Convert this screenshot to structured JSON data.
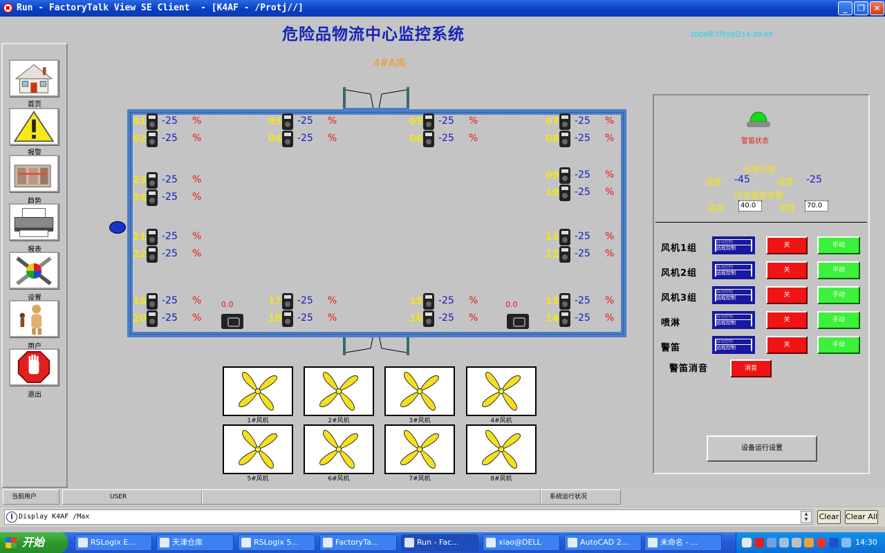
{
  "window": {
    "title": "Run - FactoryTalk View SE Client  - [K4AF - /Protj//]",
    "btn_minimize": "_",
    "btn_maximize": "❐",
    "btn_close": "✕"
  },
  "header": {
    "system_title": "危险品物流中心监控系统",
    "datetime": "2009年7月09日14:30:09"
  },
  "nav": [
    {
      "label": "首页",
      "icon": "home-icon"
    },
    {
      "label": "报警",
      "icon": "warning-icon"
    },
    {
      "label": "趋势",
      "icon": "trend-icon"
    },
    {
      "label": "报表",
      "icon": "printer-icon"
    },
    {
      "label": "设置",
      "icon": "settings-icon"
    },
    {
      "label": "用户",
      "icon": "user-icon"
    },
    {
      "label": "退出",
      "icon": "stop-hand-icon"
    }
  ],
  "warehouse": {
    "title": "4#A库",
    "percent_sign": "%",
    "value": "-25",
    "camera_reading": "0.0",
    "sensors": [
      {
        "num": "01"
      },
      {
        "num": "02"
      },
      {
        "num": "03"
      },
      {
        "num": "04"
      },
      {
        "num": "05"
      },
      {
        "num": "06"
      },
      {
        "num": "07"
      },
      {
        "num": "08"
      },
      {
        "num": "23"
      },
      {
        "num": "24"
      },
      {
        "num": "09"
      },
      {
        "num": "10"
      },
      {
        "num": "21"
      },
      {
        "num": "22"
      },
      {
        "num": "11"
      },
      {
        "num": "12"
      },
      {
        "num": "19"
      },
      {
        "num": "20"
      },
      {
        "num": "17"
      },
      {
        "num": "18"
      },
      {
        "num": "15"
      },
      {
        "num": "16"
      },
      {
        "num": "13"
      },
      {
        "num": "14"
      }
    ]
  },
  "fans": [
    "1#风机",
    "2#风机",
    "3#风机",
    "4#风机",
    "5#风机",
    "6#风机",
    "7#风机",
    "8#风机"
  ],
  "right_panel": {
    "alarm_status": "警笛状态",
    "env_title": "仓库环境",
    "temp_label": "温度",
    "temp_value": "-45",
    "humid_label": "湿度",
    "humid_value": "-25",
    "params_title": "环境报警参数",
    "param_temp_label": "温度",
    "param_temp_value": "40.0",
    "param_humid_label": "湿度",
    "param_humid_value": "70.0",
    "devices": [
      {
        "label": "风机1组"
      },
      {
        "label": "风机2组"
      },
      {
        "label": "风机3组"
      },
      {
        "label": "喷淋"
      },
      {
        "label": "警笛"
      }
    ],
    "status_line1": "自动控制",
    "status_line2": "远程控制",
    "off_label": "关",
    "manual_label": "手动",
    "mute_label": "警笛消音",
    "mute_button": "消音",
    "settings_button": "设备运行设置"
  },
  "status_strip": {
    "current_user_label": "当前用户",
    "user": "USER",
    "system_status": "系统运行状况"
  },
  "command": {
    "info_icon": "i",
    "text": "Display K4AF /Max",
    "clear": "Clear",
    "clear_all": "Clear All",
    "spin_up": "▲",
    "spin_down": "▼"
  },
  "taskbar": {
    "start": "开始",
    "tasks": [
      "RSLogix E...",
      "天津仓库",
      "RSLogix 5...",
      "FactoryTa...",
      "Run - Fac...",
      "xiao@DELL",
      "AutoCAD 2...",
      "未命名 - ..."
    ],
    "clock": "14:30"
  }
}
